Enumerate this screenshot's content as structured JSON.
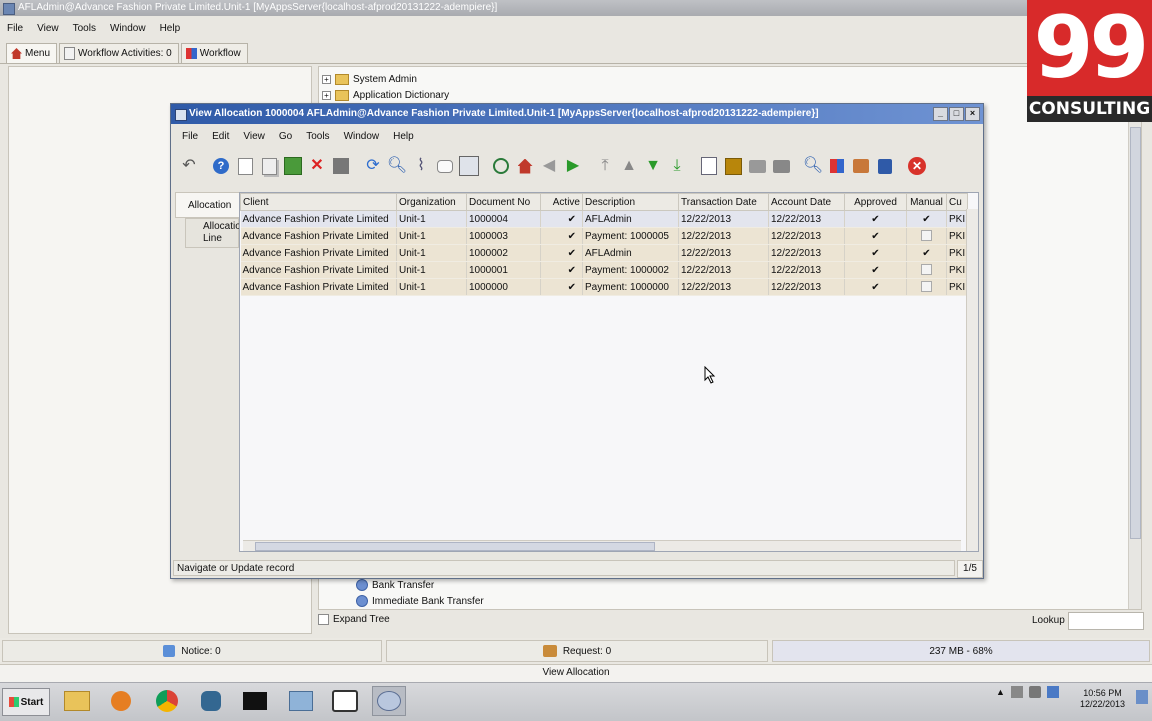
{
  "main": {
    "title": "AFLAdmin@Advance Fashion Private Limited.Unit-1 [MyAppsServer{localhost-afprod20131222-adempiere}]",
    "menu": [
      "File",
      "View",
      "Tools",
      "Window",
      "Help"
    ],
    "tabs": [
      {
        "label": "Menu"
      },
      {
        "label": "Workflow Activities: 0"
      },
      {
        "label": "Workflow"
      }
    ]
  },
  "tree": {
    "items": [
      {
        "label": "System Admin"
      },
      {
        "label": "Application Dictionary"
      }
    ],
    "bottom_items": [
      {
        "label": "Bank Transfer"
      },
      {
        "label": "Immediate Bank Transfer"
      }
    ],
    "expand_tree_label": "Expand Tree",
    "lookup_label": "Lookup"
  },
  "dialog": {
    "title": "View Allocation  1000004  AFLAdmin@Advance Fashion Private Limited.Unit-1 [MyAppsServer{localhost-afprod20131222-adempiere}]",
    "menu": [
      "File",
      "Edit",
      "View",
      "Go",
      "Tools",
      "Window",
      "Help"
    ],
    "side_tabs": {
      "allocation": "Allocation",
      "allocation_line": "Allocation Line"
    },
    "columns": [
      "Client",
      "Organization",
      "Document No",
      "Active",
      "Description",
      "Transaction Date",
      "Account Date",
      "Approved",
      "Manual",
      "Cu"
    ],
    "rows": [
      {
        "client": "Advance Fashion Private Limited",
        "org": "Unit-1",
        "doc": "1000004",
        "active": "✔",
        "desc": "AFLAdmin",
        "trx_date": "12/22/2013",
        "acct_date": "12/22/2013",
        "approved": "✔",
        "manual": "✔",
        "cur": "PKI"
      },
      {
        "client": "Advance Fashion Private Limited",
        "org": "Unit-1",
        "doc": "1000003",
        "active": "✔",
        "desc": "Payment: 1000005",
        "trx_date": "12/22/2013",
        "acct_date": "12/22/2013",
        "approved": "✔",
        "manual": "",
        "cur": "PKI"
      },
      {
        "client": "Advance Fashion Private Limited",
        "org": "Unit-1",
        "doc": "1000002",
        "active": "✔",
        "desc": "AFLAdmin",
        "trx_date": "12/22/2013",
        "acct_date": "12/22/2013",
        "approved": "✔",
        "manual": "✔",
        "cur": "PKI"
      },
      {
        "client": "Advance Fashion Private Limited",
        "org": "Unit-1",
        "doc": "1000001",
        "active": "✔",
        "desc": "Payment: 1000002",
        "trx_date": "12/22/2013",
        "acct_date": "12/22/2013",
        "approved": "✔",
        "manual": "",
        "cur": "PKI"
      },
      {
        "client": "Advance Fashion Private Limited",
        "org": "Unit-1",
        "doc": "1000000",
        "active": "✔",
        "desc": "Payment: 1000000",
        "trx_date": "12/22/2013",
        "acct_date": "12/22/2013",
        "approved": "✔",
        "manual": "",
        "cur": "PKI"
      }
    ],
    "status": "Navigate or Update record",
    "record_count": "1/5"
  },
  "status_bar": {
    "notice": "Notice: 0",
    "request": "Request: 0",
    "memory": "237 MB - 68%",
    "info": "View Allocation"
  },
  "taskbar": {
    "start": "Start",
    "clock_time": "10:56 PM",
    "clock_date": "12/22/2013"
  },
  "logo": {
    "number": "99",
    "text": "CONSULTING"
  },
  "colors": {
    "dialog_title": "#2f5aa8",
    "row_bg": "#ece4d3",
    "logo_red": "#d82a2a"
  }
}
